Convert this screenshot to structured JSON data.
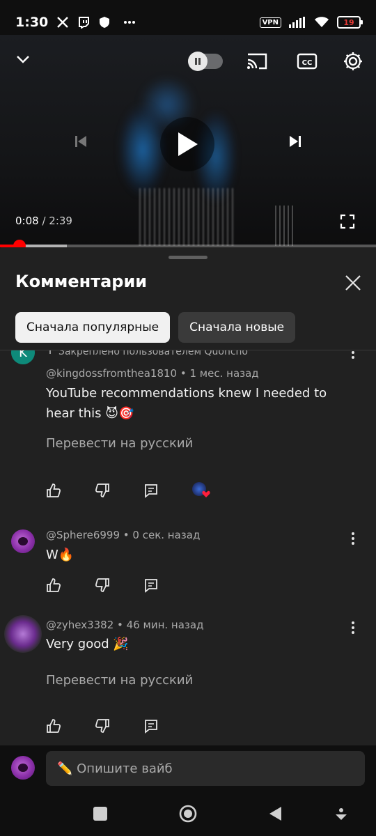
{
  "status_bar": {
    "time": "1:30",
    "vpn": "VPN",
    "battery": "19",
    "icons": [
      "x-icon",
      "twitch-icon",
      "shield-icon",
      "more-dots-icon",
      "signal-icon",
      "wifi-icon"
    ]
  },
  "player": {
    "current_time": "0:08",
    "separator": " / ",
    "duration": "2:39",
    "progress_fraction": 0.05
  },
  "comments_sheet": {
    "title": "Комментарии",
    "chips": [
      {
        "label": "Сначала популярные",
        "active": true
      },
      {
        "label": "Сначала новые",
        "active": false
      }
    ],
    "comments": [
      {
        "avatar_letter": "K",
        "pinned_text": "Закреплено пользователем Quoncho",
        "author": "@kingdossfromthea1810",
        "time": "1 мес. назад",
        "text": "YouTube recommendations knew I needed to hear this 😈🎯",
        "translate": "Перевести на русский",
        "creator_heart": true
      },
      {
        "author": "@Sphere6999",
        "time": "0 сек. назад",
        "text": "W🔥"
      },
      {
        "author": "@zyhex3382",
        "time": "46 мин. назад",
        "text": "Very good 🎉",
        "translate": "Перевести на русский"
      }
    ],
    "meta_separator": " • "
  },
  "input": {
    "placeholder": "✏️ Опишите вайб"
  },
  "colors": {
    "accent_red": "#ff0000",
    "sheet_bg": "#212121",
    "page_bg": "#0f0f0f"
  }
}
